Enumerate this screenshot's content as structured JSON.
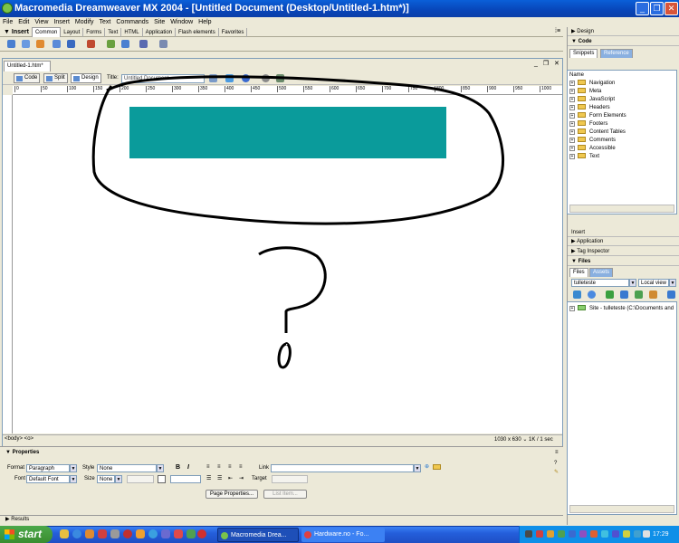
{
  "window": {
    "title": "Macromedia Dreamweaver MX 2004 - [Untitled Document (Desktop/Untitled-1.htm*)]"
  },
  "menubar": [
    "File",
    "Edit",
    "View",
    "Insert",
    "Modify",
    "Text",
    "Commands",
    "Site",
    "Window",
    "Help"
  ],
  "insert_bar": {
    "title": "Insert",
    "tabs": [
      "Common",
      "Layout",
      "Forms",
      "Text",
      "HTML",
      "Application",
      "Flash elements",
      "Favorites"
    ],
    "active_tab": "Common"
  },
  "document": {
    "tab_label": "Untitled-1.htm*",
    "view_buttons": [
      "Code",
      "Split",
      "Design"
    ],
    "active_view": "Design",
    "title_label": "Title:",
    "title_value": "Untitled Document",
    "ruler_labels": [
      "0",
      "50",
      "100",
      "150",
      "200",
      "250",
      "300",
      "350",
      "400",
      "450",
      "500",
      "550",
      "600",
      "650",
      "700",
      "750",
      "800",
      "850",
      "900",
      "950",
      "1000"
    ],
    "tag_selector": "<body> <o>",
    "status_info": "1030 x 630 ⌄ 1K / 1 sec"
  },
  "properties": {
    "title": "Properties",
    "format_label": "Format",
    "format_value": "Paragraph",
    "style_label": "Style",
    "style_value": "None",
    "bold": "B",
    "italic": "I",
    "link_label": "Link",
    "font_label": "Font",
    "font_value": "Default Font",
    "size_label": "Size",
    "size_value": "None",
    "target_label": "Target",
    "page_properties_button": "Page Properties...",
    "list_item_button": "List Item..."
  },
  "results": "Results",
  "right_panel": {
    "design": "Design",
    "code": "Code",
    "snippets_tab": "Snippets",
    "reference_tab": "Reference",
    "name_header": "Name",
    "snippets": [
      "Navigation",
      "Meta",
      "JavaScript",
      "Headers",
      "Form Elements",
      "Footers",
      "Content Tables",
      "Comments",
      "Accessible",
      "Text"
    ],
    "insert_label": "Insert",
    "application": "Application",
    "tag_inspector": "Tag Inspector",
    "files": "Files",
    "files_tab": "Files",
    "assets_tab": "Assets",
    "site_select": "tulleteste",
    "view_select": "Local view",
    "site_entry": "Site - tulleteste (C:\\Documents and"
  },
  "taskbar": {
    "start": "start",
    "tasks": [
      "Macromedia Drea...",
      "Hardware.no - Fo..."
    ],
    "clock": "17:29"
  },
  "colors": {
    "teal_box": "#0a9b9b",
    "titlebar": "#0845b8",
    "taskbar": "#245edb"
  }
}
